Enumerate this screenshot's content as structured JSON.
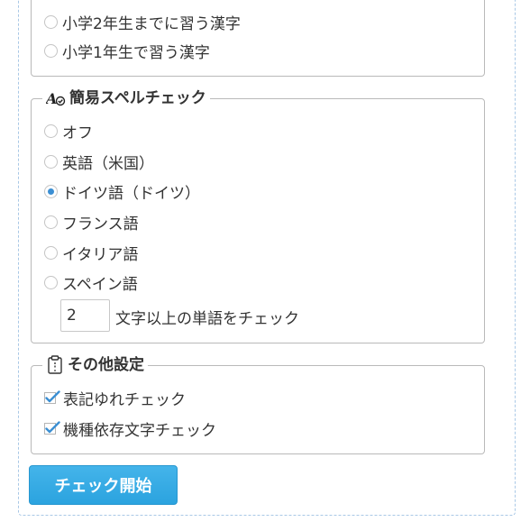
{
  "kanji_section": {
    "options": [
      {
        "label": "小学2年生までに習う漢字",
        "checked": false
      },
      {
        "label": "小学1年生で習う漢字",
        "checked": false
      }
    ]
  },
  "spell_section": {
    "legend": "簡易スペルチェック",
    "icon": "spellcheck-icon",
    "options": [
      {
        "label": "オフ",
        "checked": false
      },
      {
        "label": "英語（米国）",
        "checked": false
      },
      {
        "label": "ドイツ語（ドイツ）",
        "checked": true
      },
      {
        "label": "フランス語",
        "checked": false
      },
      {
        "label": "イタリア語",
        "checked": false
      },
      {
        "label": "スペイン語",
        "checked": false
      }
    ],
    "min_length_value": "2",
    "min_length_label": "文字以上の単語をチェック"
  },
  "other_section": {
    "legend": "その他設定",
    "icon": "clipboard-icon",
    "options": [
      {
        "label": "表記ゆれチェック",
        "checked": true
      },
      {
        "label": "機種依存文字チェック",
        "checked": true
      }
    ]
  },
  "start_button": {
    "label": "チェック開始"
  },
  "colors": {
    "accent": "#3b8fd3",
    "button": "#2ba3df"
  }
}
